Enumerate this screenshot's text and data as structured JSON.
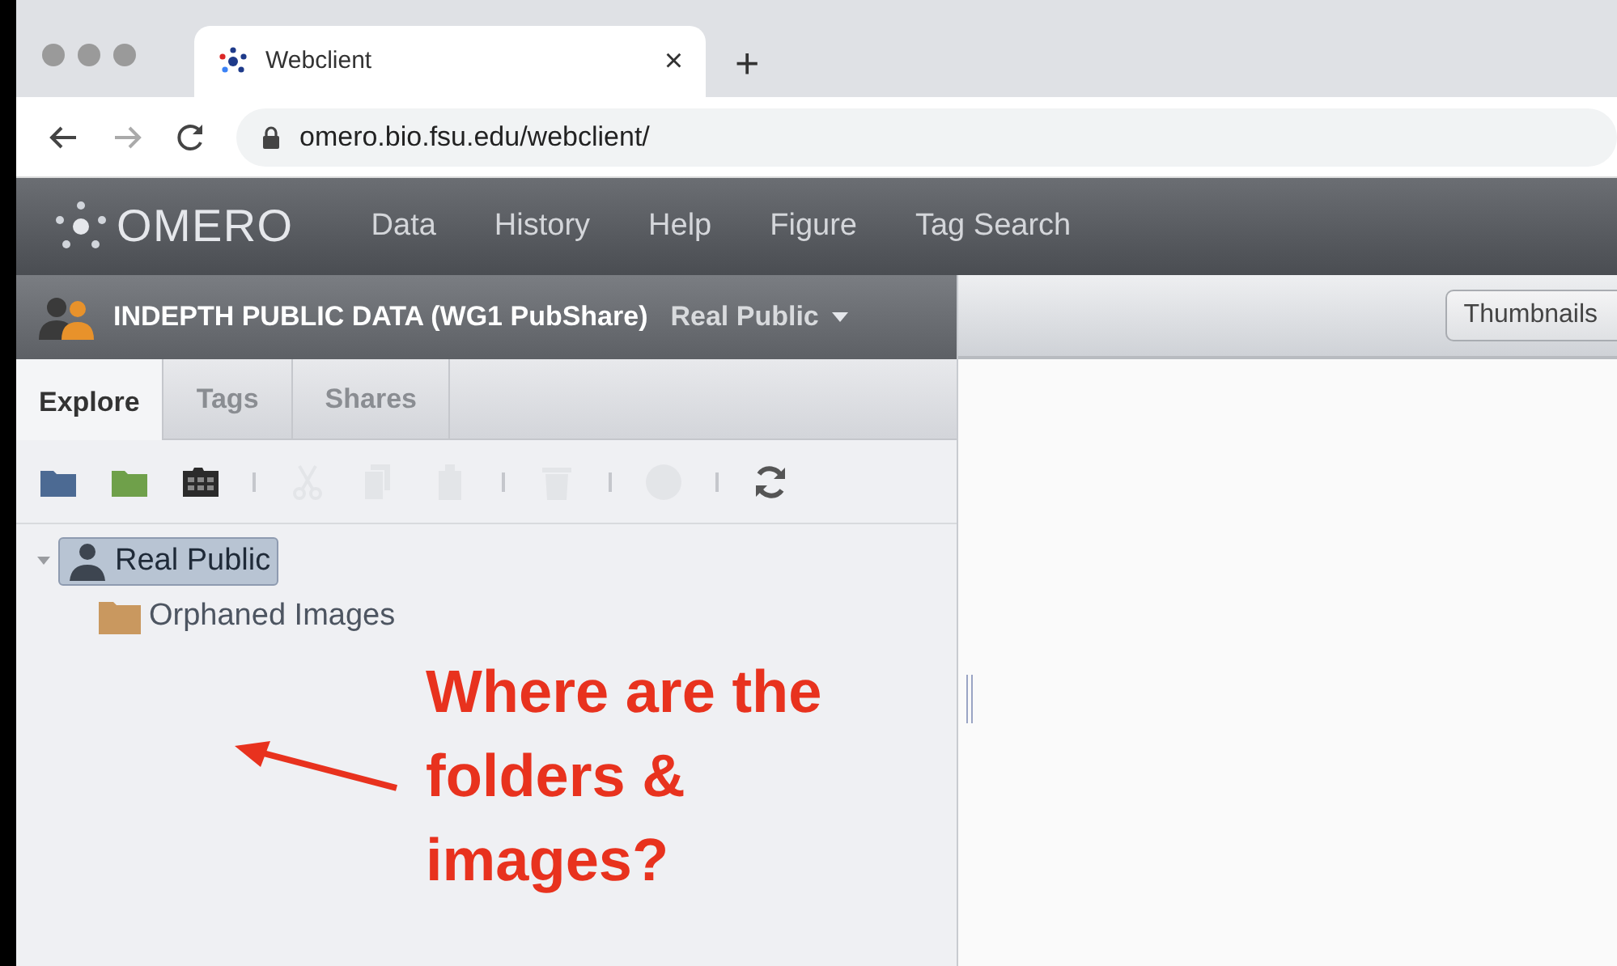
{
  "browser": {
    "tab": {
      "title": "Webclient",
      "close": "×"
    },
    "new_tab": "+",
    "url": "omero.bio.fsu.edu/webclient/"
  },
  "app": {
    "logo": "OMERO",
    "nav": [
      "Data",
      "History",
      "Help",
      "Figure",
      "Tag Search"
    ]
  },
  "group_bar": {
    "group": "INDEPTH PUBLIC DATA (WG1 PubShare)",
    "user": "Real Public"
  },
  "left_tabs": [
    {
      "label": "Explore",
      "selected": true
    },
    {
      "label": "Tags",
      "selected": false
    },
    {
      "label": "Shares",
      "selected": false
    }
  ],
  "toolbar": [
    {
      "items": [
        {
          "kind": "project",
          "disabled": false
        },
        {
          "kind": "dataset",
          "disabled": false
        },
        {
          "kind": "screen",
          "disabled": false
        }
      ]
    },
    {
      "items": [
        {
          "kind": "cut",
          "disabled": true
        },
        {
          "kind": "copy",
          "disabled": true
        },
        {
          "kind": "paste",
          "disabled": true
        }
      ]
    },
    {
      "items": [
        {
          "kind": "delete",
          "disabled": true
        }
      ]
    },
    {
      "items": [
        {
          "kind": "share",
          "disabled": true
        }
      ]
    },
    {
      "items": [
        {
          "kind": "refresh",
          "disabled": false
        }
      ]
    }
  ],
  "tree": [
    {
      "label": "Real Public",
      "kind": "user",
      "selected": true,
      "expanded": true,
      "children": [
        {
          "label": "Orphaned Images",
          "kind": "orphans",
          "selected": false
        }
      ]
    }
  ],
  "view_button": "Thumbnails",
  "annotation": "Where are the folders & images?"
}
